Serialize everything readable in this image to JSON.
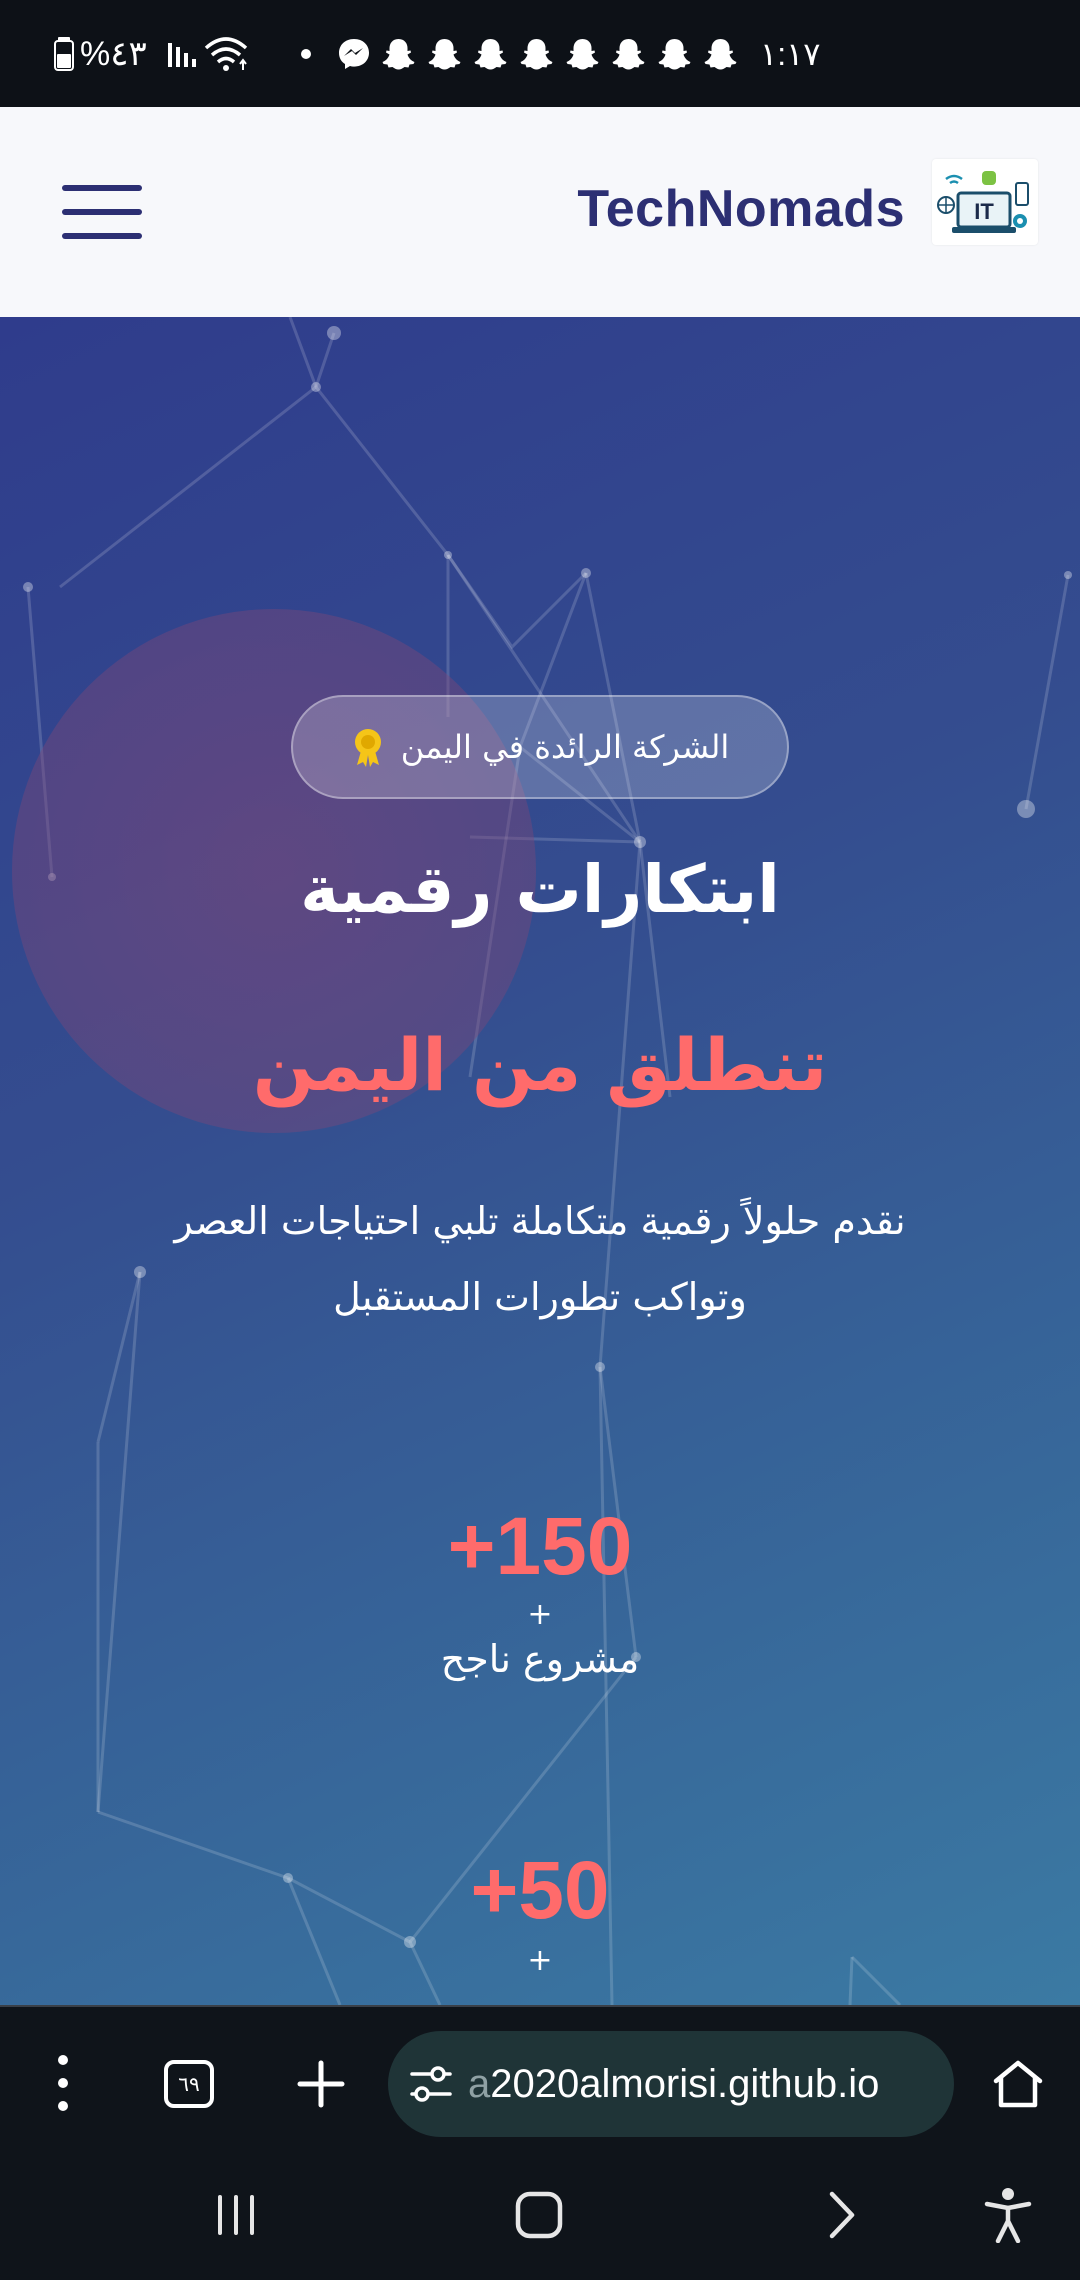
{
  "status_bar": {
    "time": "١:١٧",
    "battery": "%٤٣",
    "icons": [
      "battery-icon",
      "signal-icon",
      "wifi-icon",
      "messenger-icon",
      "snapchat-icon"
    ]
  },
  "header": {
    "brand": "TechNomads",
    "logo_text": "IT",
    "menu_icon": "hamburger-menu-icon"
  },
  "hero": {
    "badge": "الشركة الرائدة في اليمن",
    "badge_icon": "award-icon",
    "title": "ابتكارات رقمية",
    "subtitle": "تنطلق من اليمن",
    "description": "نقدم حلولاً رقمية متكاملة تلبي احتياجات العصر وتواكب تطورات المستقبل",
    "stats": [
      {
        "number": "+150",
        "plus": "+",
        "label": "مشروع ناجح"
      },
      {
        "number": "+50",
        "plus": "+"
      }
    ]
  },
  "browser": {
    "tab_count": "٦٩",
    "url_hidden_part": "a",
    "url": "2020almorisi.github.io",
    "icons": [
      "more-vert-icon",
      "tabs-icon",
      "new-tab-icon",
      "site-settings-icon",
      "home-icon"
    ]
  },
  "system_nav": {
    "icons": [
      "recents-icon",
      "home-button-icon",
      "forward-icon",
      "accessibility-icon"
    ]
  },
  "colors": {
    "brand": "#2c2f73",
    "accent": "#ff6b6b",
    "hero_start": "#2f3c8c",
    "hero_end": "#3b7aa3",
    "url_pill": "#1f3437"
  }
}
